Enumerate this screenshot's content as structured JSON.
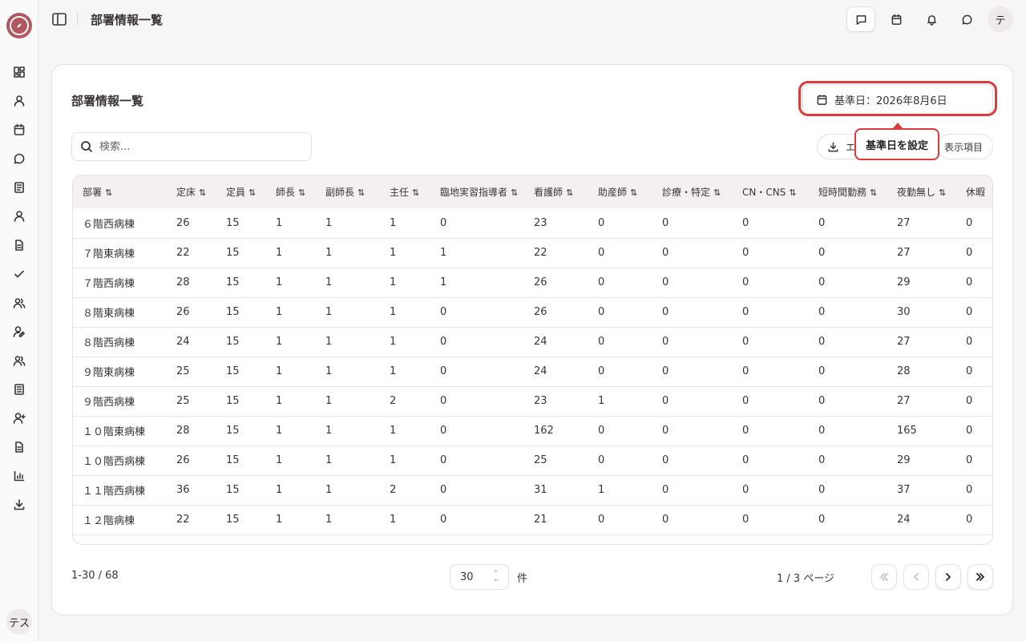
{
  "header": {
    "title": "部署情報一覧"
  },
  "sidebar": {
    "user_initials": "テス",
    "icons": [
      "dashboard-icon",
      "user-icon",
      "calendar-icon",
      "chat-icon",
      "document-icon",
      "person-icon",
      "file-icon",
      "check-icon",
      "users-icon",
      "user-edit-icon",
      "group-icon",
      "list-icon",
      "user-plus-icon",
      "file-text-icon",
      "chart-icon",
      "download-icon"
    ]
  },
  "topbar": {
    "avatar": "テ"
  },
  "card": {
    "title": "部署情報一覧",
    "base_date_label": "基準日：2026年8月6日",
    "tooltip": "基準日を設定",
    "search_placeholder": "検索...",
    "export_label": "エ",
    "columns_label": "表示項目"
  },
  "table": {
    "columns": [
      "部署",
      "定床",
      "定員",
      "師長",
      "副師長",
      "主任",
      "臨地実習指導者",
      "看護師",
      "助産師",
      "診療・特定",
      "CN・CNS",
      "短時間勤務",
      "夜勤無し",
      "休暇"
    ],
    "rows": [
      [
        "６階西病棟",
        "26",
        "15",
        "1",
        "1",
        "1",
        "0",
        "23",
        "0",
        "0",
        "0",
        "0",
        "27",
        "0"
      ],
      [
        "７階東病棟",
        "22",
        "15",
        "1",
        "1",
        "1",
        "1",
        "22",
        "0",
        "0",
        "0",
        "0",
        "27",
        "0"
      ],
      [
        "７階西病棟",
        "28",
        "15",
        "1",
        "1",
        "1",
        "1",
        "26",
        "0",
        "0",
        "0",
        "0",
        "29",
        "0"
      ],
      [
        "８階東病棟",
        "26",
        "15",
        "1",
        "1",
        "1",
        "0",
        "26",
        "0",
        "0",
        "0",
        "0",
        "30",
        "0"
      ],
      [
        "８階西病棟",
        "24",
        "15",
        "1",
        "1",
        "1",
        "0",
        "24",
        "0",
        "0",
        "0",
        "0",
        "27",
        "0"
      ],
      [
        "９階東病棟",
        "25",
        "15",
        "1",
        "1",
        "1",
        "0",
        "24",
        "0",
        "0",
        "0",
        "0",
        "28",
        "0"
      ],
      [
        "９階西病棟",
        "25",
        "15",
        "1",
        "1",
        "2",
        "0",
        "23",
        "1",
        "0",
        "0",
        "0",
        "27",
        "0"
      ],
      [
        "１０階東病棟",
        "28",
        "15",
        "1",
        "1",
        "1",
        "0",
        "162",
        "0",
        "0",
        "0",
        "0",
        "165",
        "0"
      ],
      [
        "１０階西病棟",
        "26",
        "15",
        "1",
        "1",
        "1",
        "0",
        "25",
        "0",
        "0",
        "0",
        "0",
        "29",
        "0"
      ],
      [
        "１１階西病棟",
        "36",
        "15",
        "1",
        "1",
        "2",
        "0",
        "31",
        "1",
        "0",
        "0",
        "0",
        "37",
        "0"
      ],
      [
        "１２階病棟",
        "22",
        "15",
        "1",
        "1",
        "1",
        "0",
        "21",
        "0",
        "0",
        "0",
        "0",
        "24",
        "0"
      ]
    ]
  },
  "pagination": {
    "range": "1-30 / 68",
    "page_size": "30",
    "unit": "件",
    "page_info": "1 / 3 ページ"
  }
}
